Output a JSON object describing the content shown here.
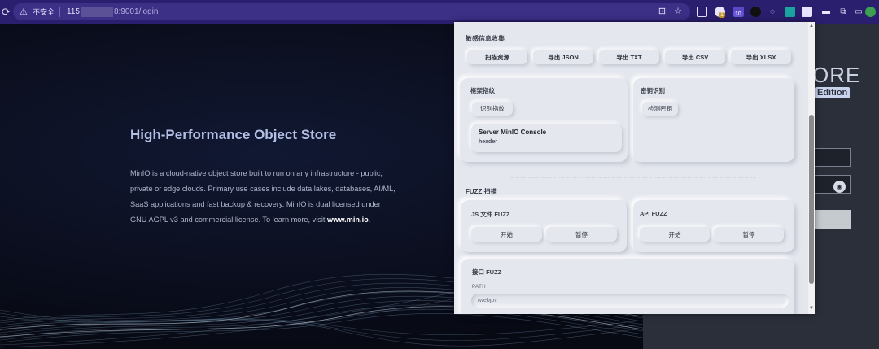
{
  "browser": {
    "reload_icon": "reload-icon",
    "security_label": "不安全",
    "url_prefix": "115",
    "url_suffix": "8:9001/login",
    "icons": [
      "translate-icon",
      "bookmark-star-icon",
      "extension-icon",
      "extension-icon",
      "extension-icon",
      "extension-icon",
      "extension-icon",
      "extension-icon",
      "puzzle-icon",
      "sidebar-icon",
      "profile-avatar"
    ],
    "badge_1": "1",
    "badge_2": "10"
  },
  "minio": {
    "hero_title": "High-Performance Object Store",
    "desc_text": "MinIO is a cloud-native object store built to run on any infrastructure - public, private or edge clouds. Primary use cases include data lakes, databases, AI/ML, SaaS applications and fast backup & recovery. MinIO is dual licensed under GNU AGPL v3 and commercial license. To learn more, visit ",
    "desc_link": "www.min.io",
    "desc_end": ".",
    "brand_partial": "ORE",
    "edition_partial": "Edition",
    "accent": "#c9d3ee"
  },
  "popup": {
    "sensitive_title": "敏感信息收集",
    "sensitive_buttons": [
      "扫描资源",
      "导出 JSON",
      "导出 TXT",
      "导出 CSV",
      "导出 XLSX"
    ],
    "framework_title": "框架指纹",
    "framework_button": "识别指纹",
    "fingerprint_name": "Server MinIO Console",
    "fingerprint_location": "header",
    "secret_title": "密钥识别",
    "secret_button": "检测密钥",
    "fuzz_title": "FUZZ 扫描",
    "js_fuzz_title": "JS 文件 FUZZ",
    "api_fuzz_title": "API FUZZ",
    "start_label": "开始",
    "pause_label": "暂停",
    "interface_fuzz_title": "接口 FUZZ",
    "path_label": "PATH",
    "path_value": "/webjpv"
  }
}
